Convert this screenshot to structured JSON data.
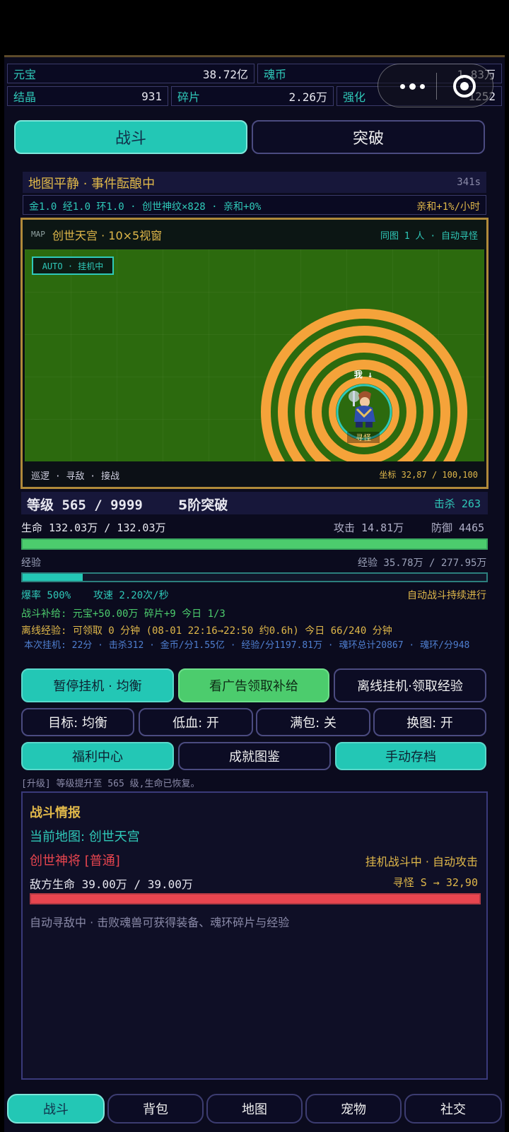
{
  "resources": {
    "yuanbao_label": "元宝",
    "yuanbao_value": "38.72亿",
    "hunbi_label": "魂币",
    "hunbi_value": "1.83万",
    "jiejing_label": "结晶",
    "jiejing_value": "931",
    "suipian_label": "碎片",
    "suipian_value": "2.26万",
    "qianghua_label": "强化",
    "qianghua_value": "1252"
  },
  "tabs": {
    "battle": "战斗",
    "breakthrough": "突破"
  },
  "status": {
    "map_state": "地图平静 · 事件酝酿中",
    "timer": "341s",
    "rates": "金1.0 经1.0 环1.0 · 创世神纹×828 · 亲和+0%",
    "affinity_rate": "亲和+1%/小时"
  },
  "map": {
    "tag": "MAP",
    "title": "创世天宫 · 10×5视窗",
    "same_map": "同图 1 人 · 自动寻怪",
    "auto_badge": "AUTO · 挂机中",
    "hero_label_top": "我 ↓",
    "hero_label_bottom": "寻怪",
    "footer_modes": "巡逻 · 寻敌 · 接战",
    "coord": "坐标 32,87 / 100,100"
  },
  "player": {
    "level": "等级 565 / 9999",
    "rank": "5阶突破",
    "kills": "击杀 263",
    "hp": "生命 132.03万 / 132.03万",
    "attack": "攻击 14.81万",
    "defense": "防御 4465",
    "hp_ratio": 1.0,
    "exp_label": "经验",
    "exp": "经验 35.78万 / 277.95万",
    "exp_ratio": 0.129,
    "crit": "爆率 500%",
    "speed": "攻速 2.20次/秒",
    "auto_battle": "自动战斗持续进行"
  },
  "rewards": {
    "supply": "战斗补给: 元宝+50.00万  碎片+9  今日 1/3",
    "offline": "离线经验: 可领取 0 分钟 (08-01 22:16→22:50 约0.6h)  今日 66/240 分钟",
    "session": "本次挂机: 22分 · 击杀312 · 金币/分1.55亿 · 经验/分1197.81万 · 魂环总计20867 · 魂环/分948"
  },
  "buttons": {
    "pause": "暂停挂机 · 均衡",
    "ad": "看广告领取补给",
    "offline": "离线挂机·领取经验",
    "target": "目标: 均衡",
    "low_hp": "低血: 开",
    "full_bag": "满包: 关",
    "switch_map": "换图: 开",
    "welfare": "福利中心",
    "achievement": "成就图鉴",
    "save": "手动存档"
  },
  "log": "[升级] 等级提升至 565 级,生命已恢复。",
  "report": {
    "title": "战斗情报",
    "current_map": "当前地图: 创世天宫",
    "enemy": "创世神将 [普通]",
    "state": "挂机战斗中 · 自动攻击",
    "enemy_hp": "敌方生命 39.00万 / 39.00万",
    "enemy_hp_ratio": 1.0,
    "seek": "寻怪 S → 32,90",
    "hint": "自动寻敌中 · 击败魂兽可获得装备、魂环碎片与经验"
  },
  "nav": {
    "battle": "战斗",
    "bag": "背包",
    "map": "地图",
    "pet": "宠物",
    "social": "社交"
  },
  "colors": {
    "teal": "#23c7b5",
    "gold": "#e0b84a",
    "red": "#e8454f",
    "green": "#4ccc6d",
    "orange": "#f5a33a",
    "grass": "#2c6a0e"
  }
}
